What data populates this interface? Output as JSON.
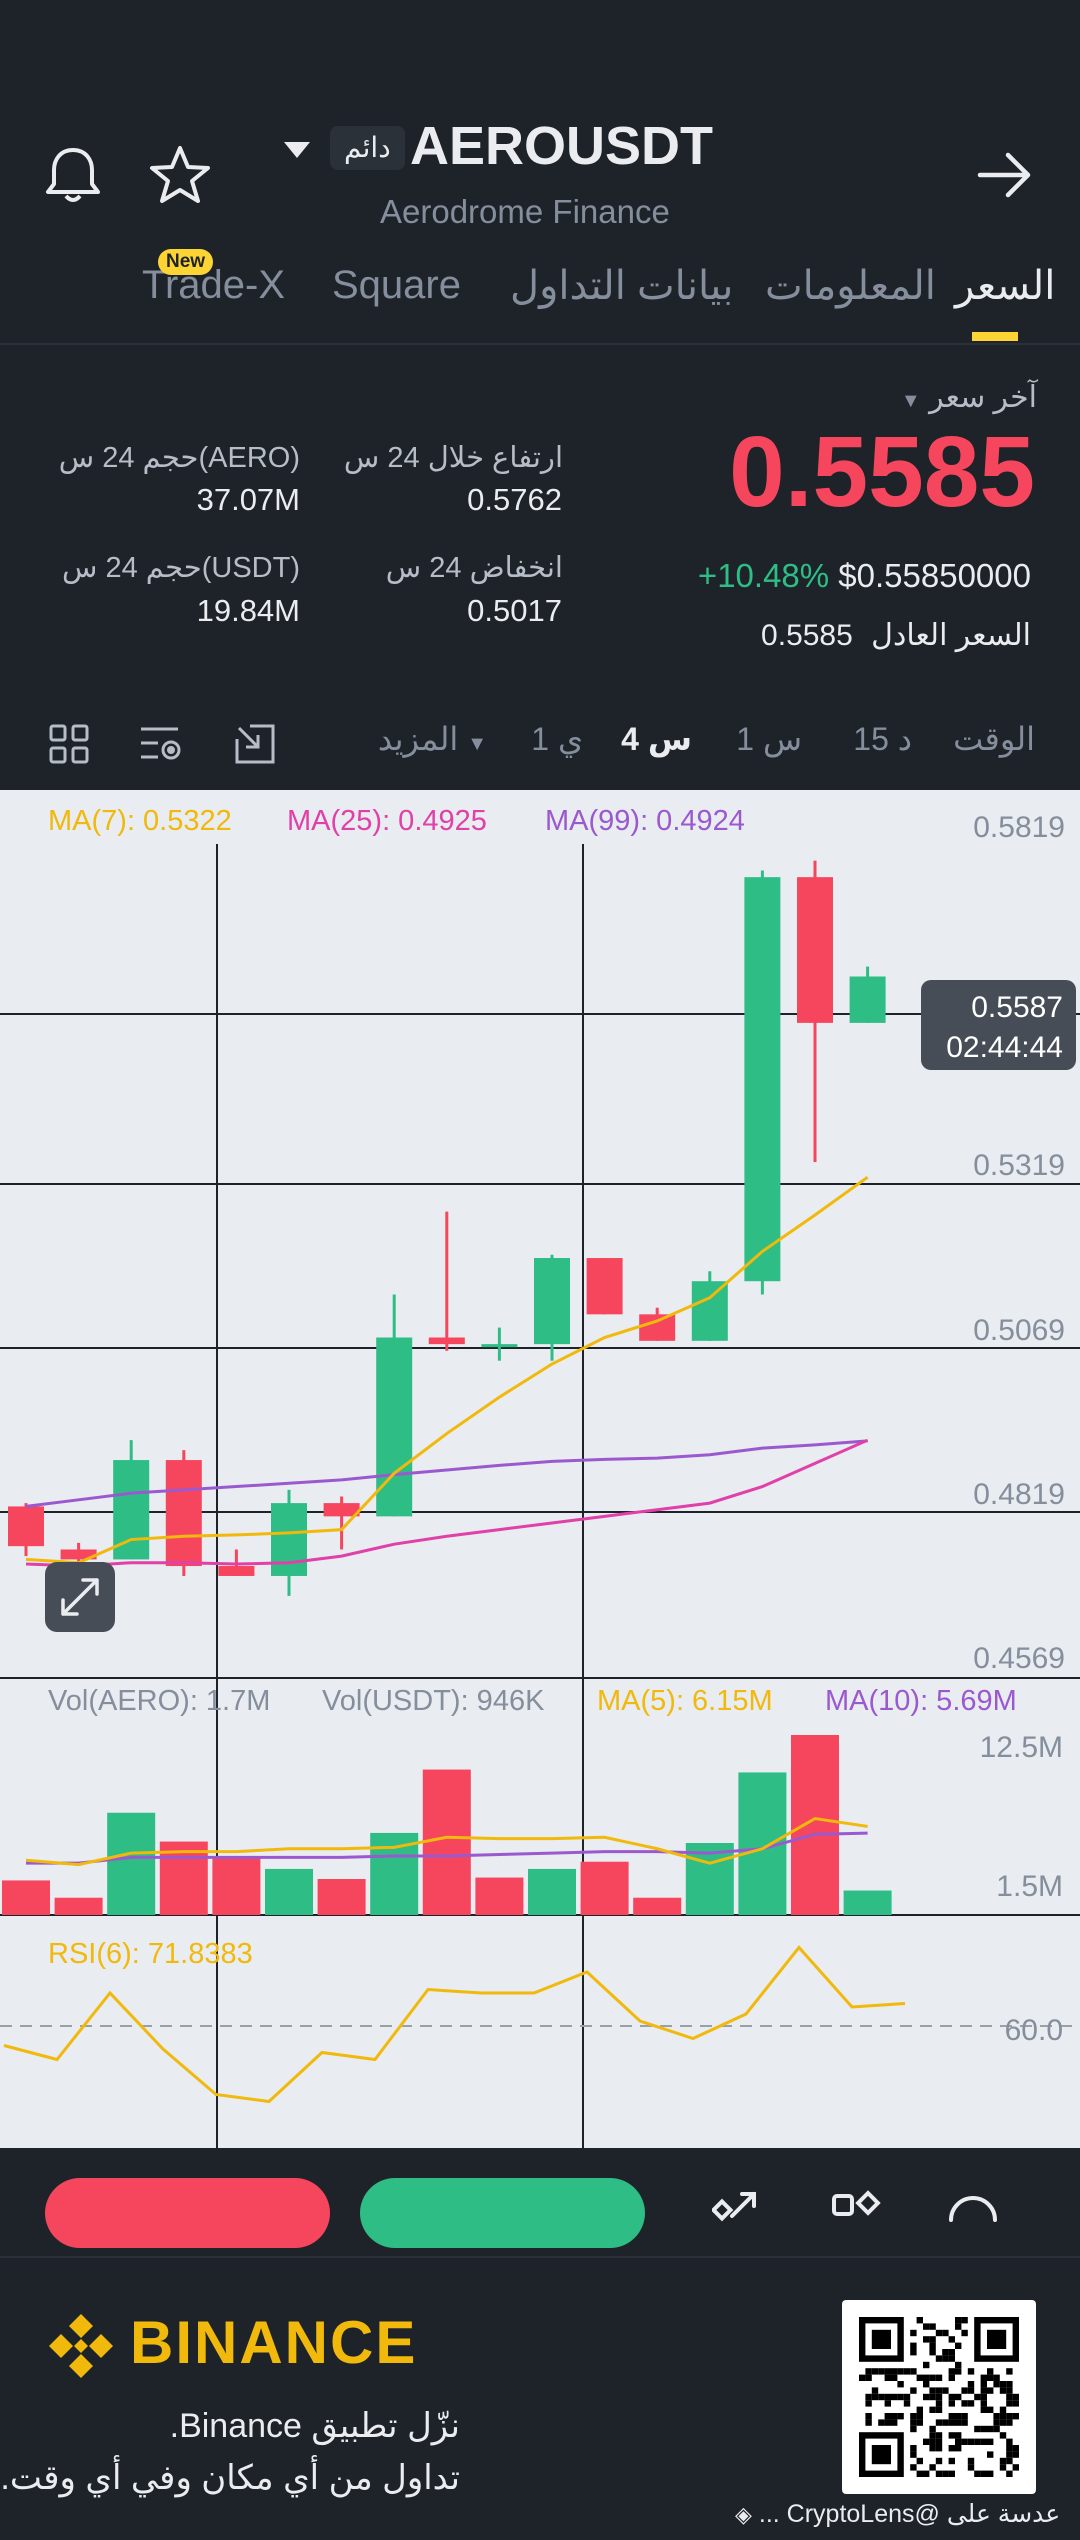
{
  "header": {
    "symbol": "AEROUSDT",
    "badge": "دائم",
    "subtitle": "Aerodrome Finance",
    "tabs": [
      {
        "label": "السعر",
        "active": true
      },
      {
        "label": "المعلومات",
        "active": false
      },
      {
        "label": "بيانات التداول",
        "active": false
      },
      {
        "label": "Square",
        "active": false
      },
      {
        "label": "Trade-X",
        "active": false,
        "badge": "New"
      }
    ]
  },
  "price": {
    "last_label": "آخر سعر",
    "last": "0.5585",
    "change": "+10.48%",
    "usd": "$0.55850000",
    "fair_label": "السعر العادل",
    "fair": "0.5585",
    "high_label": "ارتفاع خلال 24 س",
    "high": "0.5762",
    "low_label": "انخفاض 24 س",
    "low": "0.5017",
    "vol_base_label": "حجم 24 س(AERO)",
    "vol_base": "37.07M",
    "vol_quote_label": "حجم 24 س(USDT)",
    "vol_quote": "19.84M"
  },
  "timeframes": {
    "label": "الوقت",
    "items": [
      "15 د",
      "1 س",
      "4 س",
      "1 ي"
    ],
    "active": "4 س",
    "more": "المزيد"
  },
  "chart": {
    "ma7": "MA(7): 0.5322",
    "ma25": "MA(25): 0.4925",
    "ma99": "MA(99): 0.4924",
    "price_ticks": [
      "0.5819",
      "0.5319",
      "0.5069",
      "0.4819",
      "0.4569"
    ],
    "current_price": "0.5587",
    "countdown": "02:44:44",
    "vol_base": "Vol(AERO): 1.7M",
    "vol_quote": "Vol(USDT): 946K",
    "vma5": "MA(5): 6.15M",
    "vma10": "MA(10): 5.69M",
    "vol_ticks": [
      "12.5M",
      "1.5M"
    ],
    "rsi": "RSI(6): 71.8383",
    "rsi_tick": "60.0"
  },
  "colors": {
    "up": "#2ebd85",
    "down": "#f6465d",
    "accent": "#fcd535",
    "ma7": "#f0b90b",
    "ma25": "#e040a8",
    "ma99": "#9b59d0"
  },
  "chart_data": {
    "type": "candlestick",
    "candles": [
      {
        "o": 0.4825,
        "h": 0.483,
        "l": 0.475,
        "c": 0.4765
      },
      {
        "o": 0.476,
        "h": 0.477,
        "l": 0.473,
        "c": 0.4745
      },
      {
        "o": 0.4745,
        "h": 0.4925,
        "l": 0.4745,
        "c": 0.4895
      },
      {
        "o": 0.4895,
        "h": 0.491,
        "l": 0.472,
        "c": 0.4735
      },
      {
        "o": 0.4735,
        "h": 0.476,
        "l": 0.472,
        "c": 0.472
      },
      {
        "o": 0.472,
        "h": 0.485,
        "l": 0.469,
        "c": 0.483
      },
      {
        "o": 0.483,
        "h": 0.484,
        "l": 0.476,
        "c": 0.481
      },
      {
        "o": 0.481,
        "h": 0.5145,
        "l": 0.481,
        "c": 0.508
      },
      {
        "o": 0.508,
        "h": 0.527,
        "l": 0.506,
        "c": 0.507
      },
      {
        "o": 0.507,
        "h": 0.5095,
        "l": 0.5045,
        "c": 0.507
      },
      {
        "o": 0.507,
        "h": 0.5205,
        "l": 0.5045,
        "c": 0.52
      },
      {
        "o": 0.52,
        "h": 0.52,
        "l": 0.5115,
        "c": 0.5115
      },
      {
        "o": 0.5115,
        "h": 0.5125,
        "l": 0.5075,
        "c": 0.5075
      },
      {
        "o": 0.5075,
        "h": 0.518,
        "l": 0.5075,
        "c": 0.5165
      },
      {
        "o": 0.5165,
        "h": 0.5785,
        "l": 0.5145,
        "c": 0.5775
      },
      {
        "o": 0.5775,
        "h": 0.58,
        "l": 0.5345,
        "c": 0.5555
      },
      {
        "o": 0.5555,
        "h": 0.564,
        "l": 0.5555,
        "c": 0.5625
      }
    ],
    "ma7": [
      0.4745,
      0.474,
      0.4775,
      0.478,
      0.4782,
      0.4785,
      0.479,
      0.4875,
      0.4935,
      0.499,
      0.504,
      0.508,
      0.5105,
      0.514,
      0.521,
      0.5265,
      0.5322
    ],
    "ma25": [
      0.4738,
      0.4735,
      0.474,
      0.474,
      0.4738,
      0.474,
      0.475,
      0.4768,
      0.478,
      0.479,
      0.48,
      0.481,
      0.482,
      0.483,
      0.4855,
      0.489,
      0.4925
    ],
    "ma99": [
      0.4825,
      0.4835,
      0.4845,
      0.485,
      0.4855,
      0.486,
      0.4865,
      0.4873,
      0.488,
      0.4887,
      0.4893,
      0.4896,
      0.4898,
      0.4903,
      0.4913,
      0.4918,
      0.4924
    ],
    "volume": [
      2.4,
      1.2,
      7.1,
      5.1,
      4.0,
      3.2,
      2.5,
      5.7,
      10.1,
      2.6,
      3.2,
      3.7,
      1.2,
      5.0,
      9.9,
      12.5,
      1.7
    ],
    "volume_colors": [
      "down",
      "down",
      "up",
      "down",
      "down",
      "up",
      "down",
      "up",
      "down",
      "down",
      "up",
      "down",
      "down",
      "up",
      "up",
      "down",
      "up"
    ],
    "vma5": [
      3.8,
      3.5,
      4.3,
      4.4,
      4.4,
      4.6,
      4.6,
      4.7,
      5.4,
      5.3,
      5.3,
      5.4,
      4.6,
      3.6,
      4.6,
      6.7,
      6.15
    ],
    "vma10": [
      3.6,
      3.6,
      4.0,
      4.0,
      4.0,
      4.0,
      4.0,
      4.1,
      4.1,
      4.2,
      4.3,
      4.4,
      4.4,
      4.3,
      4.6,
      5.6,
      5.69
    ],
    "rsi6": [
      47,
      43,
      62,
      46,
      33,
      31,
      45,
      43,
      63,
      62,
      62,
      68,
      54,
      49,
      56,
      75,
      58,
      59
    ],
    "y_range": [
      0.4569,
      0.5819
    ],
    "vol_range": [
      0,
      12.5
    ],
    "rsi_range": [
      20,
      80
    ]
  },
  "actions": {
    "icons": [
      "share-icon",
      "compare-icon",
      "gauge-icon"
    ]
  },
  "footer": {
    "brand": "BINANCE",
    "line1": "نزّل تطبيق Binance.",
    "line2": "تداول من أي مكان وفي أي وقت.",
    "watermark": "... CryptoLens@ عدسة على"
  }
}
